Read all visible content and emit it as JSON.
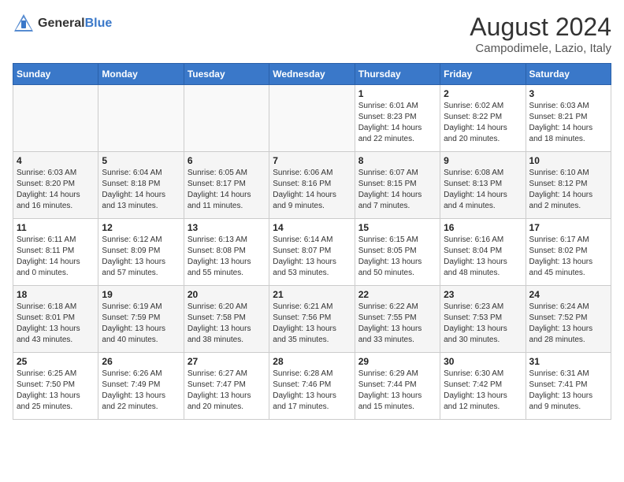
{
  "header": {
    "logo_line1": "General",
    "logo_line2": "Blue",
    "month_year": "August 2024",
    "location": "Campodimele, Lazio, Italy"
  },
  "weekdays": [
    "Sunday",
    "Monday",
    "Tuesday",
    "Wednesday",
    "Thursday",
    "Friday",
    "Saturday"
  ],
  "weeks": [
    [
      {
        "day": "",
        "info": ""
      },
      {
        "day": "",
        "info": ""
      },
      {
        "day": "",
        "info": ""
      },
      {
        "day": "",
        "info": ""
      },
      {
        "day": "1",
        "info": "Sunrise: 6:01 AM\nSunset: 8:23 PM\nDaylight: 14 hours\nand 22 minutes."
      },
      {
        "day": "2",
        "info": "Sunrise: 6:02 AM\nSunset: 8:22 PM\nDaylight: 14 hours\nand 20 minutes."
      },
      {
        "day": "3",
        "info": "Sunrise: 6:03 AM\nSunset: 8:21 PM\nDaylight: 14 hours\nand 18 minutes."
      }
    ],
    [
      {
        "day": "4",
        "info": "Sunrise: 6:03 AM\nSunset: 8:20 PM\nDaylight: 14 hours\nand 16 minutes."
      },
      {
        "day": "5",
        "info": "Sunrise: 6:04 AM\nSunset: 8:18 PM\nDaylight: 14 hours\nand 13 minutes."
      },
      {
        "day": "6",
        "info": "Sunrise: 6:05 AM\nSunset: 8:17 PM\nDaylight: 14 hours\nand 11 minutes."
      },
      {
        "day": "7",
        "info": "Sunrise: 6:06 AM\nSunset: 8:16 PM\nDaylight: 14 hours\nand 9 minutes."
      },
      {
        "day": "8",
        "info": "Sunrise: 6:07 AM\nSunset: 8:15 PM\nDaylight: 14 hours\nand 7 minutes."
      },
      {
        "day": "9",
        "info": "Sunrise: 6:08 AM\nSunset: 8:13 PM\nDaylight: 14 hours\nand 4 minutes."
      },
      {
        "day": "10",
        "info": "Sunrise: 6:10 AM\nSunset: 8:12 PM\nDaylight: 14 hours\nand 2 minutes."
      }
    ],
    [
      {
        "day": "11",
        "info": "Sunrise: 6:11 AM\nSunset: 8:11 PM\nDaylight: 14 hours\nand 0 minutes."
      },
      {
        "day": "12",
        "info": "Sunrise: 6:12 AM\nSunset: 8:09 PM\nDaylight: 13 hours\nand 57 minutes."
      },
      {
        "day": "13",
        "info": "Sunrise: 6:13 AM\nSunset: 8:08 PM\nDaylight: 13 hours\nand 55 minutes."
      },
      {
        "day": "14",
        "info": "Sunrise: 6:14 AM\nSunset: 8:07 PM\nDaylight: 13 hours\nand 53 minutes."
      },
      {
        "day": "15",
        "info": "Sunrise: 6:15 AM\nSunset: 8:05 PM\nDaylight: 13 hours\nand 50 minutes."
      },
      {
        "day": "16",
        "info": "Sunrise: 6:16 AM\nSunset: 8:04 PM\nDaylight: 13 hours\nand 48 minutes."
      },
      {
        "day": "17",
        "info": "Sunrise: 6:17 AM\nSunset: 8:02 PM\nDaylight: 13 hours\nand 45 minutes."
      }
    ],
    [
      {
        "day": "18",
        "info": "Sunrise: 6:18 AM\nSunset: 8:01 PM\nDaylight: 13 hours\nand 43 minutes."
      },
      {
        "day": "19",
        "info": "Sunrise: 6:19 AM\nSunset: 7:59 PM\nDaylight: 13 hours\nand 40 minutes."
      },
      {
        "day": "20",
        "info": "Sunrise: 6:20 AM\nSunset: 7:58 PM\nDaylight: 13 hours\nand 38 minutes."
      },
      {
        "day": "21",
        "info": "Sunrise: 6:21 AM\nSunset: 7:56 PM\nDaylight: 13 hours\nand 35 minutes."
      },
      {
        "day": "22",
        "info": "Sunrise: 6:22 AM\nSunset: 7:55 PM\nDaylight: 13 hours\nand 33 minutes."
      },
      {
        "day": "23",
        "info": "Sunrise: 6:23 AM\nSunset: 7:53 PM\nDaylight: 13 hours\nand 30 minutes."
      },
      {
        "day": "24",
        "info": "Sunrise: 6:24 AM\nSunset: 7:52 PM\nDaylight: 13 hours\nand 28 minutes."
      }
    ],
    [
      {
        "day": "25",
        "info": "Sunrise: 6:25 AM\nSunset: 7:50 PM\nDaylight: 13 hours\nand 25 minutes."
      },
      {
        "day": "26",
        "info": "Sunrise: 6:26 AM\nSunset: 7:49 PM\nDaylight: 13 hours\nand 22 minutes."
      },
      {
        "day": "27",
        "info": "Sunrise: 6:27 AM\nSunset: 7:47 PM\nDaylight: 13 hours\nand 20 minutes."
      },
      {
        "day": "28",
        "info": "Sunrise: 6:28 AM\nSunset: 7:46 PM\nDaylight: 13 hours\nand 17 minutes."
      },
      {
        "day": "29",
        "info": "Sunrise: 6:29 AM\nSunset: 7:44 PM\nDaylight: 13 hours\nand 15 minutes."
      },
      {
        "day": "30",
        "info": "Sunrise: 6:30 AM\nSunset: 7:42 PM\nDaylight: 13 hours\nand 12 minutes."
      },
      {
        "day": "31",
        "info": "Sunrise: 6:31 AM\nSunset: 7:41 PM\nDaylight: 13 hours\nand 9 minutes."
      }
    ]
  ]
}
